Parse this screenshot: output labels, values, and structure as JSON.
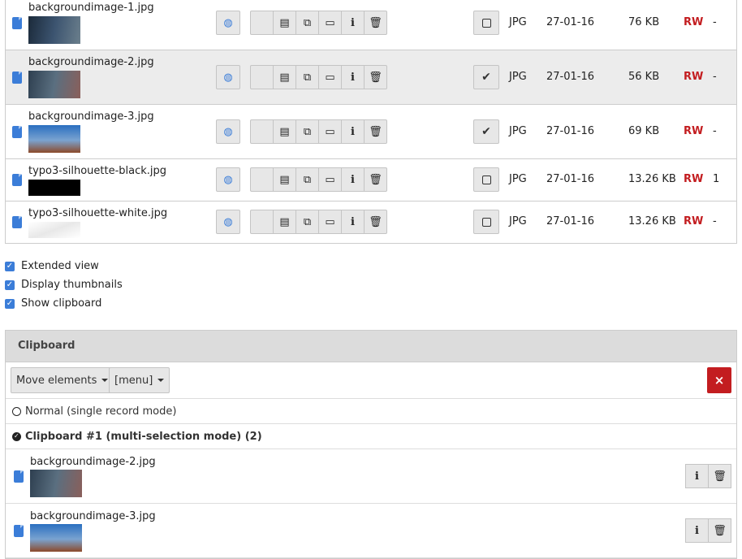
{
  "files": [
    {
      "name": "backgroundimage-1.jpg",
      "type": "JPG",
      "date": "27-01-16",
      "size": "76 KB",
      "perm": "RW",
      "refs": "-",
      "checked": false,
      "thumb": [
        "#1b2a3a",
        "#3c5470",
        "#6b7f8c"
      ]
    },
    {
      "name": "backgroundimage-2.jpg",
      "type": "JPG",
      "date": "27-01-16",
      "size": "56 KB",
      "perm": "RW",
      "refs": "-",
      "checked": true,
      "thumb": [
        "#2e3f50",
        "#5a6f80",
        "#8a5f5a"
      ]
    },
    {
      "name": "backgroundimage-3.jpg",
      "type": "JPG",
      "date": "27-01-16",
      "size": "69 KB",
      "perm": "RW",
      "refs": "-",
      "checked": true,
      "thumb": [
        "#2a6fc0",
        "#7aa3d0",
        "#8c4a2a"
      ]
    },
    {
      "name": "typo3-silhouette-black.jpg",
      "type": "JPG",
      "date": "27-01-16",
      "size": "13.26 KB",
      "perm": "RW",
      "refs": "1",
      "checked": false,
      "thumb": [
        "#000000",
        "#0a0a0a",
        "#000000"
      ]
    },
    {
      "name": "typo3-silhouette-white.jpg",
      "type": "JPG",
      "date": "27-01-16",
      "size": "13.26 KB",
      "perm": "RW",
      "refs": "-",
      "checked": false,
      "thumb": [
        "#ffffff",
        "#f2f2f2",
        "#ffffff"
      ]
    }
  ],
  "icons": {
    "file": "image-file-icon",
    "preview": "globe-preview-icon",
    "edit": "edit-metadata-icon",
    "replace": "replace-icon",
    "rename": "rename-icon",
    "info": "info-icon",
    "delete": "trash-icon",
    "check": "check-icon"
  },
  "options": [
    {
      "label": "Extended view",
      "checked": true
    },
    {
      "label": "Display thumbnails",
      "checked": true
    },
    {
      "label": "Show clipboard",
      "checked": true
    }
  ],
  "clipboard": {
    "title": "Clipboard",
    "move_label": "Move elements",
    "menu_label": "[menu]",
    "close_glyph": "×",
    "mode_normal": "Normal (single record mode)",
    "mode_multi": "Clipboard #1 (multi-selection mode) (2)",
    "items": [
      {
        "name": "backgroundimage-2.jpg",
        "thumb": [
          "#2e3f50",
          "#5a6f80",
          "#8a5f5a"
        ]
      },
      {
        "name": "backgroundimage-3.jpg",
        "thumb": [
          "#2a6fc0",
          "#7aa3d0",
          "#8c4a2a"
        ]
      }
    ]
  },
  "colors": {
    "accent": "#3b7dd8",
    "danger": "#c31d20",
    "selected_row": "#ececec"
  }
}
